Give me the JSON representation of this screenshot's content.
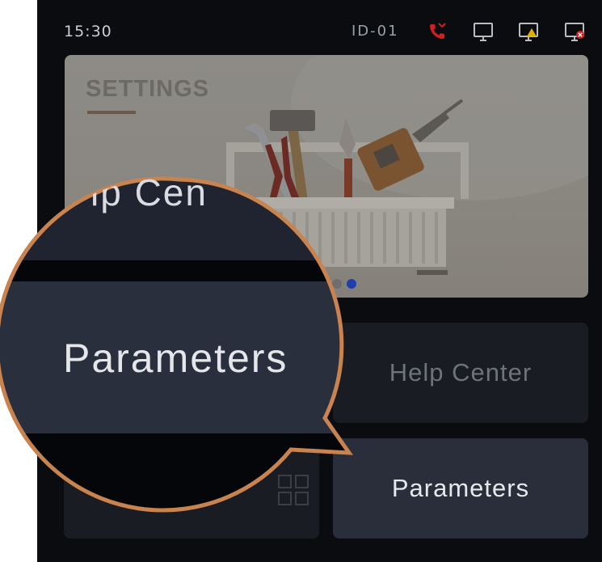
{
  "status_bar": {
    "time": "15:30",
    "device_id": "ID-01",
    "icons": [
      "missed-call-icon",
      "monitor-icon",
      "monitor-warning-icon",
      "monitor-error-icon"
    ],
    "missed_call_color": "#d11f1f",
    "warning_color": "#e0b000",
    "error_color": "#d11f1f"
  },
  "banner": {
    "title": "SETTINGS",
    "active_page": 2,
    "page_count": 2,
    "accent_color": "#1f3fae"
  },
  "tiles": {
    "help_center": "Help Center",
    "parameters": "Parameters"
  },
  "magnifier": {
    "partial_label": "lp Cen",
    "label": "Parameters",
    "ring_color": "#c8834f"
  }
}
